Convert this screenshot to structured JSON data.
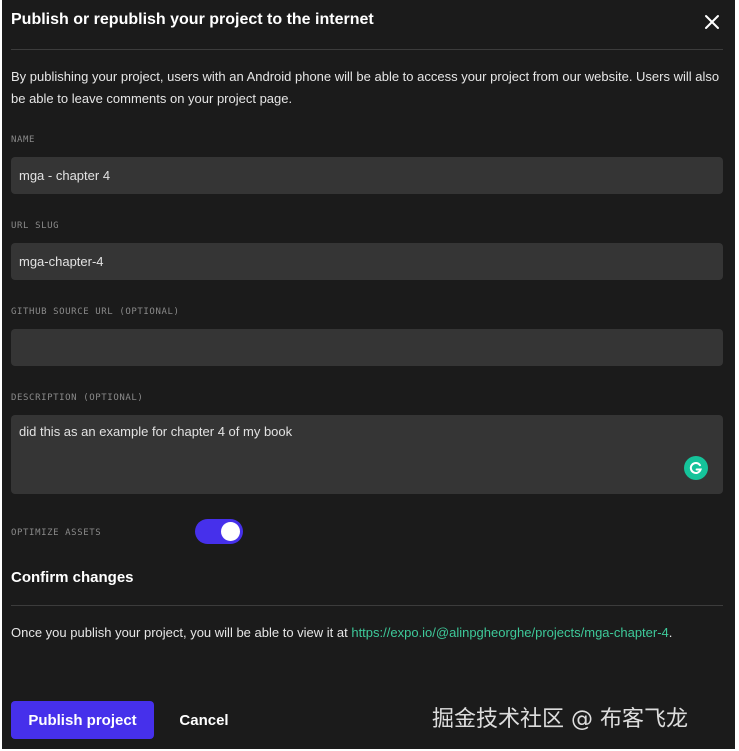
{
  "dialog": {
    "title": "Publish or republish your project to the internet",
    "intro": "By publishing your project, users with an Android phone will be able to access your project from our website. Users will also be able to leave comments on your project page."
  },
  "form": {
    "name_label": "NAME",
    "name_value": "mga - chapter 4",
    "slug_label": "URL SLUG",
    "slug_value": "mga-chapter-4",
    "github_label": "GITHUB SOURCE URL (OPTIONAL)",
    "github_value": "",
    "description_label": "DESCRIPTION (OPTIONAL)",
    "description_value": "did this as an example for chapter 4 of my book",
    "optimize_label": "OPTIMIZE ASSETS",
    "optimize_enabled": true
  },
  "confirm": {
    "title": "Confirm changes",
    "text_before": "Once you publish your project, you will be able to view it at ",
    "link_text": "https://expo.io/@alinpgheorghe/projects/mga-chapter-4",
    "text_after": "."
  },
  "buttons": {
    "publish": "Publish project",
    "cancel": "Cancel"
  },
  "watermark": "掘金技术社区 @ 布客飞龙",
  "colors": {
    "background": "#1b1b1b",
    "field": "#353535",
    "accent": "#4630eb",
    "link": "#3ec99a",
    "grammarly": "#15c39a"
  },
  "icons": [
    "close-icon",
    "grammarly-icon"
  ]
}
